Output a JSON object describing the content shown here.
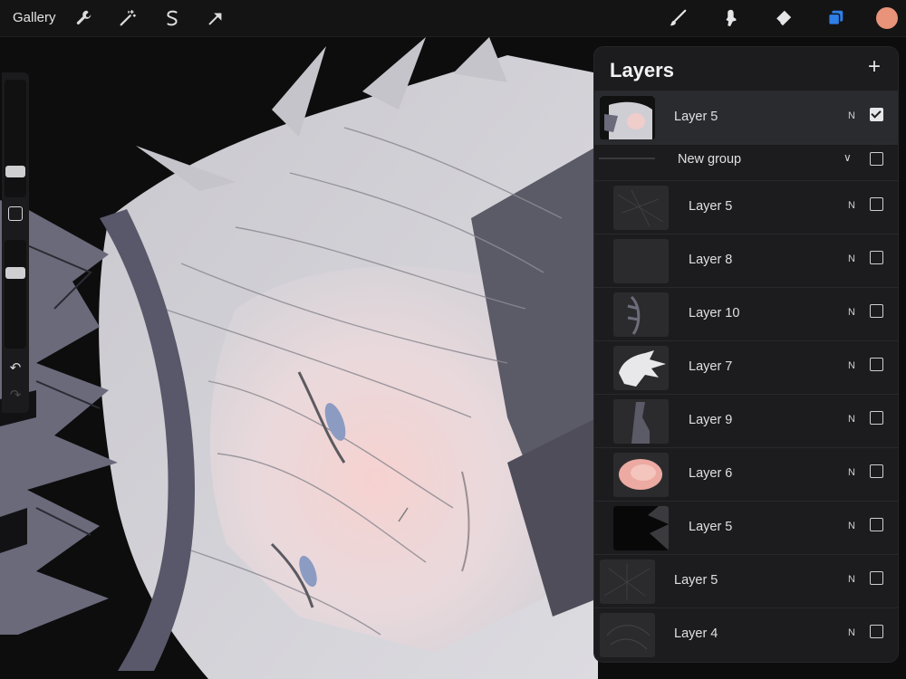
{
  "toolbar": {
    "gallery_label": "Gallery",
    "left_tools": [
      "wrench-icon",
      "magic-wand-icon",
      "selection-icon",
      "transform-arrow-icon"
    ],
    "right_tools": [
      "brush-icon",
      "smudge-icon",
      "eraser-icon",
      "layers-icon"
    ],
    "accent_color": "#2f7fe8",
    "current_color": "#e8937a"
  },
  "sidebar": {
    "brush_size_slider": 0.22,
    "opacity_slider": 0.3
  },
  "layers": {
    "title": "Layers",
    "add_icon": "plus-icon",
    "rows": [
      {
        "name": "Layer 5",
        "blend": "N",
        "visible": true,
        "active": true
      },
      {
        "name": "New group",
        "is_group": true,
        "visible": false
      },
      {
        "name": "Layer 5",
        "blend": "N",
        "visible": false
      },
      {
        "name": "Layer 8",
        "blend": "N",
        "visible": false
      },
      {
        "name": "Layer 10",
        "blend": "N",
        "visible": false
      },
      {
        "name": "Layer 7",
        "blend": "N",
        "visible": false
      },
      {
        "name": "Layer 9",
        "blend": "N",
        "visible": false
      },
      {
        "name": "Layer 6",
        "blend": "N",
        "visible": false
      },
      {
        "name": "Layer 5",
        "blend": "N",
        "visible": false
      },
      {
        "name": "Layer 5",
        "blend": "N",
        "visible": false
      },
      {
        "name": "Layer 4",
        "blend": "N",
        "visible": false
      }
    ]
  }
}
